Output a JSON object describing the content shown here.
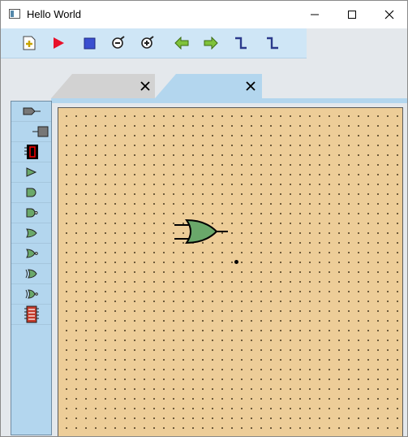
{
  "window": {
    "title": "Hello World"
  },
  "window_controls": [
    "minimize-icon",
    "maximize-icon",
    "close-icon"
  ],
  "toolbar": {
    "buttons": [
      {
        "name": "new-file-button",
        "icon": "new-file-icon"
      },
      {
        "name": "run-button",
        "icon": "play-icon"
      },
      {
        "name": "stop-button",
        "icon": "stop-icon"
      },
      {
        "name": "zoom-out-button",
        "icon": "zoom-out-icon"
      },
      {
        "name": "zoom-in-button",
        "icon": "zoom-in-icon"
      },
      {
        "name": "back-button",
        "icon": "arrow-left-icon"
      },
      {
        "name": "forward-button",
        "icon": "arrow-right-icon"
      },
      {
        "name": "route-up-button",
        "icon": "wire-up-icon"
      },
      {
        "name": "route-down-button",
        "icon": "wire-down-icon"
      }
    ]
  },
  "tabs": [
    {
      "state": "inactive",
      "close_icon": "close-icon"
    },
    {
      "state": "active",
      "close_icon": "close-icon"
    }
  ],
  "palette": {
    "items": [
      "input-pin-icon",
      "output-pin-icon",
      "seven-segment-display-icon",
      "buffer-gate-icon",
      "and-gate-icon",
      "nand-gate-icon",
      "or-gate-icon",
      "nor-gate-icon",
      "xor-gate-icon",
      "xnor-gate-icon",
      "chip-icon"
    ]
  },
  "canvas": {
    "components": [
      {
        "type": "or-gate",
        "icon": "or-gate-icon"
      }
    ],
    "background_color": "#edcd98",
    "gate_color": "#6aa86a"
  },
  "colors": {
    "toolbar": "#cfe6f6",
    "palette": "#b3d6ee",
    "accent_red": "#e8102a",
    "accent_blue": "#3a4fd0",
    "accent_green": "#7fc23a"
  }
}
